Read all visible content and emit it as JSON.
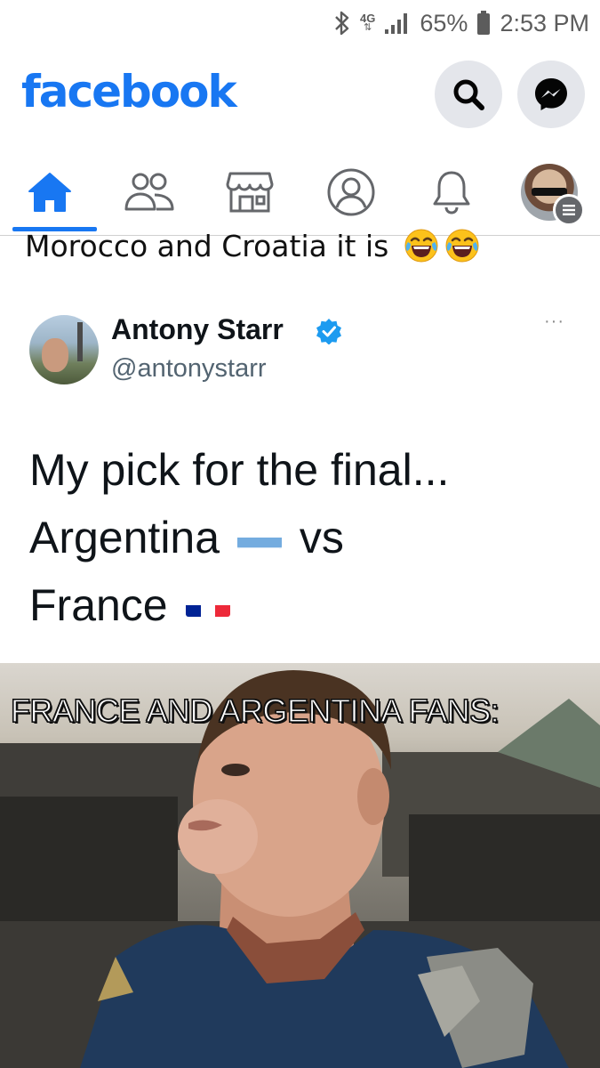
{
  "status_bar": {
    "network": "4G",
    "battery": "65%",
    "time": "2:53 PM",
    "icons": [
      "bluetooth-icon",
      "signal-icon",
      "battery-icon"
    ]
  },
  "header": {
    "brand": "facebook",
    "brand_color": "#1877f2",
    "buttons": [
      "search-icon",
      "messenger-icon"
    ]
  },
  "nav": {
    "tabs": [
      "home-icon",
      "friends-icon",
      "marketplace-icon",
      "profile-icon",
      "notifications-icon",
      "menu-avatar"
    ],
    "active": "home-icon"
  },
  "post": {
    "caption": "Morocco and Croatia it is",
    "caption_emoji": [
      "face-with-tears-of-joy",
      "face-with-tears-of-joy"
    ],
    "tweet": {
      "name": "Antony Starr",
      "handle": "@antonystarr",
      "verified": true,
      "more": "···",
      "line1": "My pick for the final...",
      "line2_word": "Argentina",
      "line2_after": "vs",
      "line3_word": "France",
      "flags": [
        "argentina-flag",
        "france-flag"
      ]
    },
    "meme_caption": "FRANCE AND ARGENTINA FANS:"
  }
}
